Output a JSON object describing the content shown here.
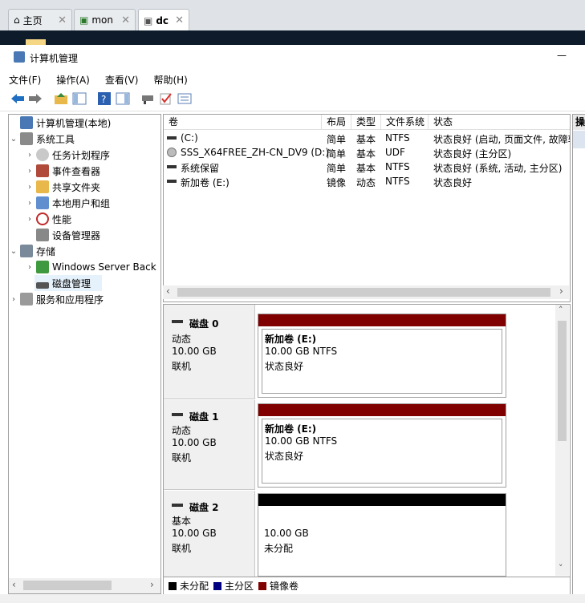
{
  "browser": {
    "tabs": [
      {
        "label": "主页",
        "icon": "home-icon"
      },
      {
        "label": "mon",
        "icon": "vm-icon"
      },
      {
        "label": "dc",
        "icon": "vm-icon",
        "active": true
      }
    ]
  },
  "window": {
    "title": "计算机管理",
    "minimize": "—"
  },
  "menu": [
    "文件(F)",
    "操作(A)",
    "查看(V)",
    "帮助(H)"
  ],
  "tree": {
    "root": "计算机管理(本地)",
    "system_tools": "系统工具",
    "task_scheduler": "任务计划程序",
    "event_viewer": "事件查看器",
    "shared_folders": "共享文件夹",
    "local_users": "本地用户和组",
    "performance": "性能",
    "device_manager": "设备管理器",
    "storage": "存储",
    "windows_server_backup": "Windows Server Back",
    "disk_management": "磁盘管理",
    "services": "服务和应用程序"
  },
  "volume_list": {
    "headers": [
      "卷",
      "布局",
      "类型",
      "文件系统",
      "状态"
    ],
    "rows": [
      {
        "name": "(C:)",
        "layout": "简单",
        "type": "基本",
        "fs": "NTFS",
        "status": "状态良好 (启动, 页面文件, 故障转"
      },
      {
        "name": "SSS_X64FREE_ZH-CN_DV9 (D:)",
        "layout": "简单",
        "type": "基本",
        "fs": "UDF",
        "status": "状态良好 (主分区)"
      },
      {
        "name": "系统保留",
        "layout": "简单",
        "type": "基本",
        "fs": "NTFS",
        "status": "状态良好 (系统, 活动, 主分区)"
      },
      {
        "name": "新加卷 (E:)",
        "layout": "镜像",
        "type": "动态",
        "fs": "NTFS",
        "status": "状态良好"
      }
    ]
  },
  "disks": [
    {
      "name": "磁盘 0",
      "kind": "动态",
      "size": "10.00 GB",
      "state": "联机",
      "bar_color": "#800000",
      "vol_name": "新加卷 (E:)",
      "vol_size": "10.00 GB NTFS",
      "vol_status": "状态良好"
    },
    {
      "name": "磁盘 1",
      "kind": "动态",
      "size": "10.00 GB",
      "state": "联机",
      "bar_color": "#800000",
      "vol_name": "新加卷 (E:)",
      "vol_size": "10.00 GB NTFS",
      "vol_status": "状态良好"
    },
    {
      "name": "磁盘 2",
      "kind": "基本",
      "size": "10.00 GB",
      "state": "联机",
      "bar_color": "#000000",
      "vol_size": "10.00 GB",
      "vol_status": "未分配"
    }
  ],
  "legend": [
    {
      "label": "未分配",
      "color": "#000000"
    },
    {
      "label": "主分区",
      "color": "#000080"
    },
    {
      "label": "镜像卷",
      "color": "#800000"
    }
  ],
  "actions_header": "操"
}
